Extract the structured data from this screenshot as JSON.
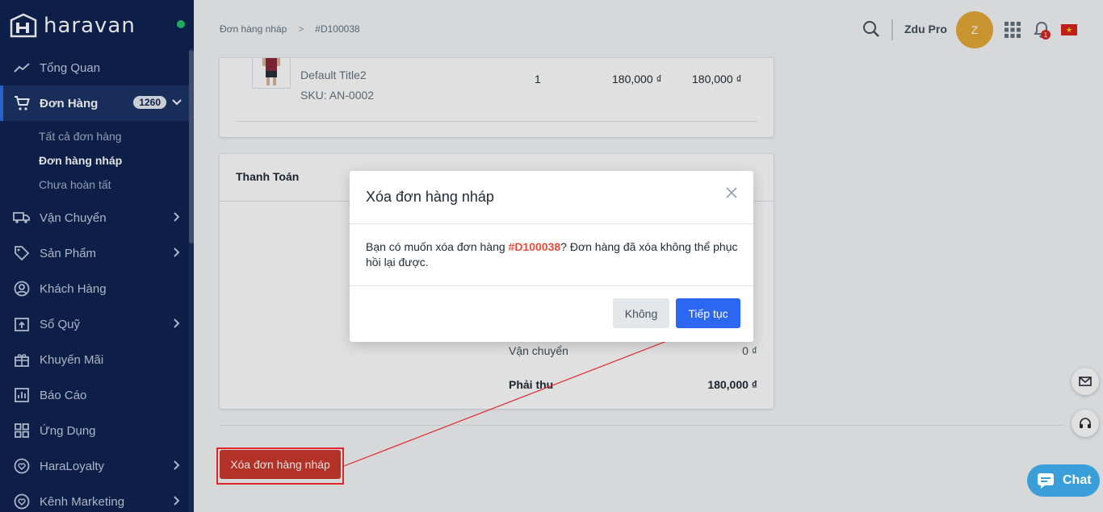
{
  "sidebar": {
    "logo_text": "haravan",
    "items": [
      {
        "label": "Tổng Quan"
      },
      {
        "label": "Đơn Hàng",
        "badge": "1260"
      },
      {
        "label": "Vận Chuyển"
      },
      {
        "label": "Sản Phẩm"
      },
      {
        "label": "Khách Hàng"
      },
      {
        "label": "Sổ Quỹ"
      },
      {
        "label": "Khuyến Mãi"
      },
      {
        "label": "Báo Cáo"
      },
      {
        "label": "Ứng Dụng"
      },
      {
        "label": "HaraLoyalty"
      },
      {
        "label": "Kênh Marketing"
      }
    ],
    "sub_items": [
      {
        "label": "Tất cả đơn hàng"
      },
      {
        "label": "Đơn hàng nháp"
      },
      {
        "label": "Chưa hoàn tất"
      }
    ]
  },
  "header": {
    "breadcrumb_parent": "Đơn hàng nháp",
    "breadcrumb_current": "#D100038",
    "user_name": "Zdu Pro",
    "avatar_initial": "Z",
    "notification_count": "1"
  },
  "product": {
    "variant": "Default Title2",
    "sku": "SKU: AN-0002",
    "quantity": "1",
    "price": "180,000 ₫",
    "total": "180,000 ₫"
  },
  "payment": {
    "title": "Thanh Toán",
    "shipping_label": "Vận chuyển",
    "shipping_value": "0 ₫",
    "due_label": "Phải thu",
    "due_value": "180,000 ₫"
  },
  "delete_button": "Xóa đơn hàng nháp",
  "modal": {
    "title": "Xóa đơn hàng nháp",
    "body_prefix": "Bạn có muốn xóa đơn hàng ",
    "body_code": "#D100038",
    "body_suffix": "? Đơn hàng đã xóa không thể phục hồi lại được.",
    "cancel_label": "Không",
    "confirm_label": "Tiếp tục"
  },
  "chat_label": "Chat",
  "colors": {
    "sidebar_bg": "#0f2452",
    "accent_blue": "#2b67f0",
    "danger_red": "#cb3a2d",
    "annotation_red": "#e1262a"
  }
}
